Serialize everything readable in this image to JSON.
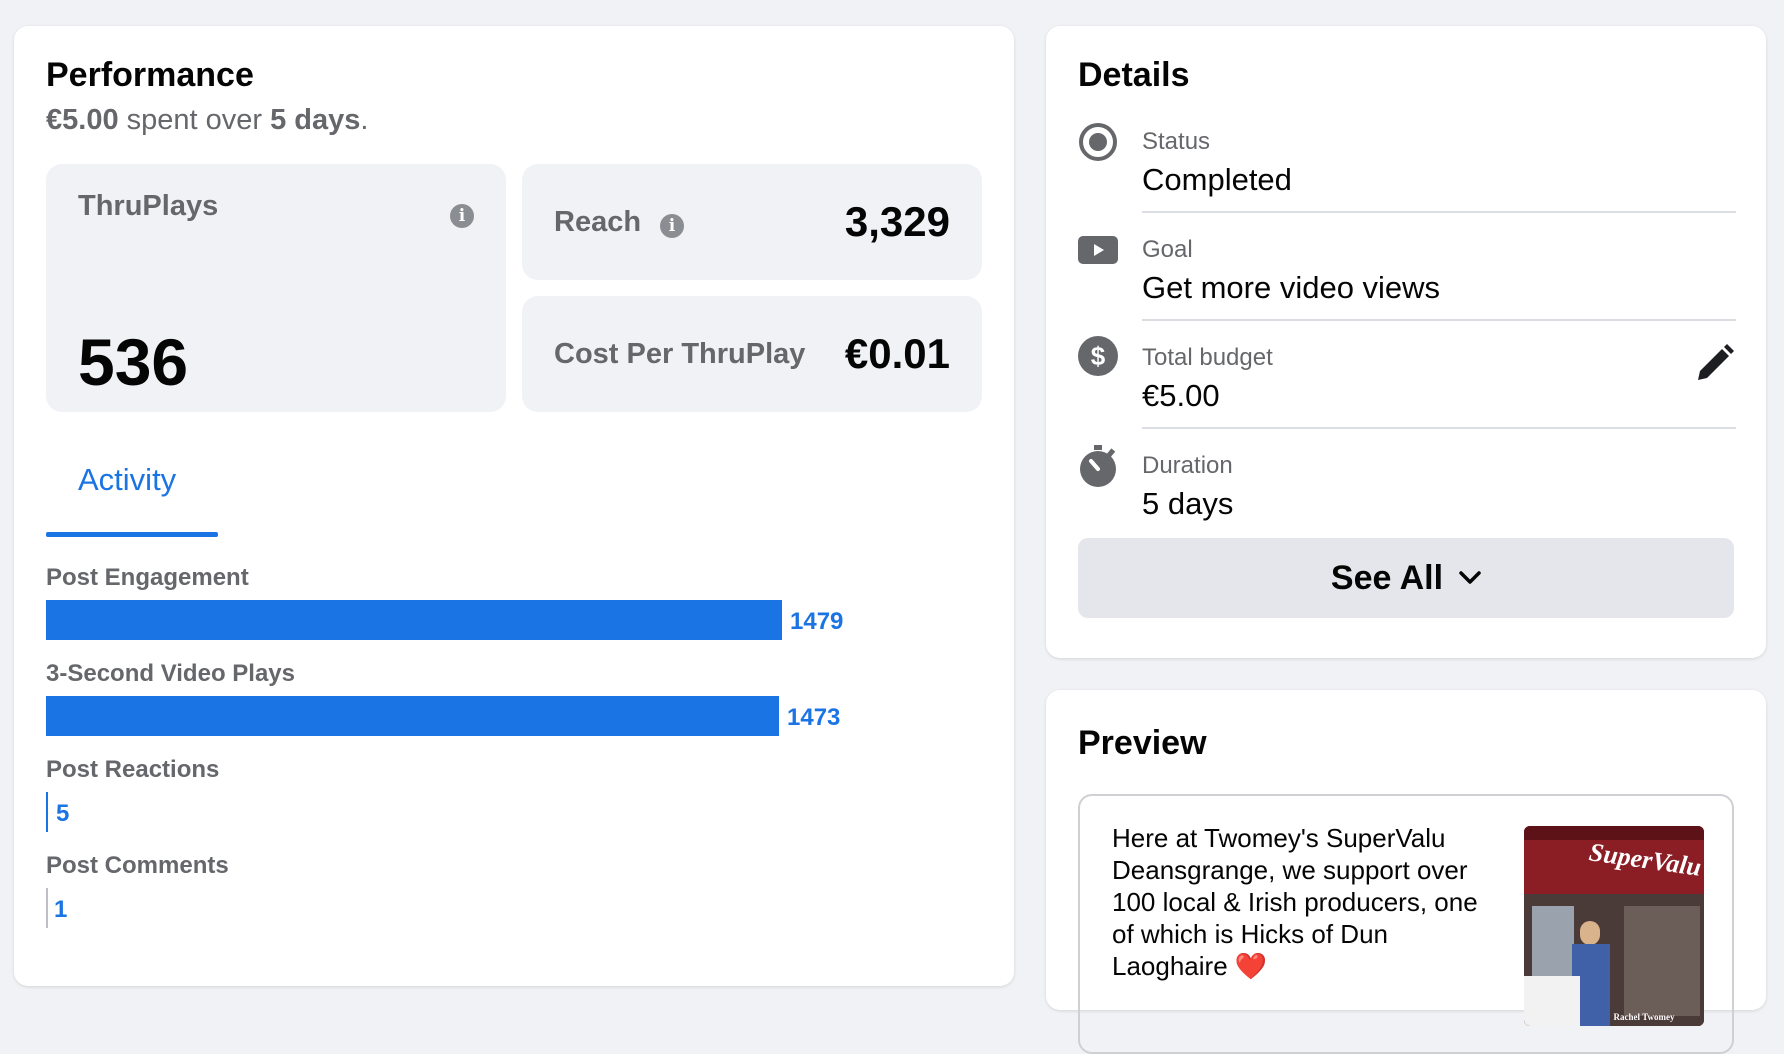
{
  "performance": {
    "title": "Performance",
    "spent": "€5.00",
    "spent_mid": " spent over ",
    "days": "5 days",
    "period_suffix": ".",
    "thruplays": {
      "label": "ThruPlays",
      "value": "536"
    },
    "reach": {
      "label": "Reach",
      "value": "3,329"
    },
    "cost": {
      "label": "Cost Per ThruPlay",
      "value": "€0.01"
    },
    "tab": "Activity",
    "activity": [
      {
        "label": "Post Engagement",
        "value": "1479"
      },
      {
        "label": "3-Second Video Plays",
        "value": "1473"
      },
      {
        "label": "Post Reactions",
        "value": "5"
      },
      {
        "label": "Post Comments",
        "value": "1"
      }
    ]
  },
  "details": {
    "title": "Details",
    "status": {
      "label": "Status",
      "value": "Completed"
    },
    "goal": {
      "label": "Goal",
      "value": "Get more video views"
    },
    "budget": {
      "label": "Total budget",
      "value": "€5.00"
    },
    "duration": {
      "label": "Duration",
      "value": "5 days"
    },
    "see_all": "See All"
  },
  "preview": {
    "title": "Preview",
    "text": "Here at Twomey's SuperValu Deansgrange, we support over 100 local & Irish producers, one of which is Hicks of Dun Laoghaire ❤️",
    "thumb_sign": "SuperValu",
    "thumb_caption": "Rachel Twomey"
  },
  "colors": {
    "accent": "#1b74e4",
    "muted": "#65676b",
    "panel": "#f0f2f5"
  },
  "icons": [
    "info-icon",
    "radio-status-icon",
    "video-goal-icon",
    "dollar-icon",
    "stopwatch-icon",
    "pencil-icon",
    "chevron-down-icon"
  ]
}
